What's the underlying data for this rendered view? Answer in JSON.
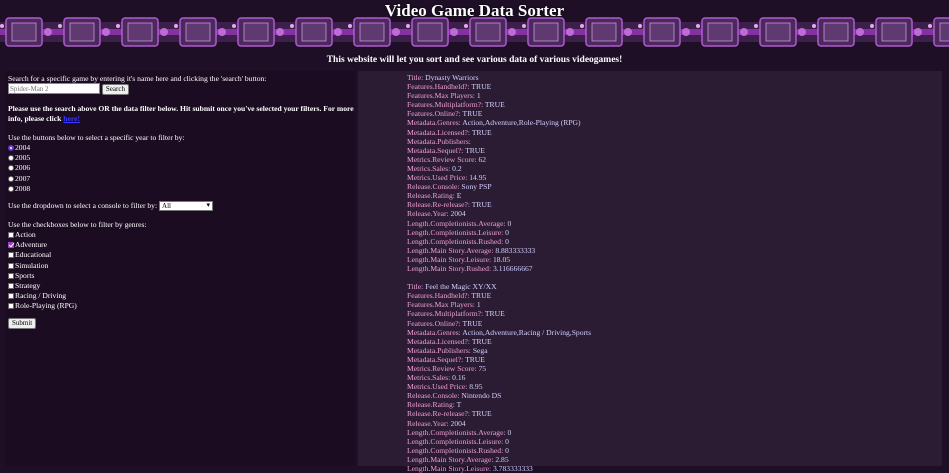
{
  "header": {
    "title": "Video Game Data Sorter",
    "subtitle": "This website will let you sort and see various data of various videogames!"
  },
  "search": {
    "instructions": "Search for a specific game by entering it's name here and clicking the 'search' button:",
    "placeholder": "Spider-Man 2",
    "button_label": "Search"
  },
  "filter_note": {
    "text": "Please use the search above OR the data filter below. Hit submit once you've selected your filters. For more info, please click",
    "link": "here!"
  },
  "year_filter": {
    "prompt": "Use the buttons below to select a specific year to filter by:",
    "options": [
      "2004",
      "2005",
      "2006",
      "2007",
      "2008"
    ],
    "selected": "2004"
  },
  "console_filter": {
    "prompt": "Use the dropdown to select a console to filter by:",
    "selected": "All"
  },
  "genre_filter": {
    "prompt": "Use the checkboxes below to filter by genres:",
    "options": [
      {
        "label": "Action",
        "checked": false
      },
      {
        "label": "Adventure",
        "checked": true
      },
      {
        "label": "Educational",
        "checked": false
      },
      {
        "label": "Simulation",
        "checked": false
      },
      {
        "label": "Sports",
        "checked": false
      },
      {
        "label": "Strategy",
        "checked": false
      },
      {
        "label": "Racing / Driving",
        "checked": false
      },
      {
        "label": "Role-Playing (RPG)",
        "checked": false
      }
    ]
  },
  "submit_label": "Submit",
  "results": [
    [
      [
        "Title: ",
        "Dynasty Warriors"
      ],
      [
        "Features.Handheld?: ",
        "TRUE"
      ],
      [
        "Features.Max Players: ",
        "1"
      ],
      [
        "Features.Multiplatform?: ",
        "TRUE"
      ],
      [
        "Features.Online?: ",
        "TRUE"
      ],
      [
        "Metadata.Genres: ",
        "Action,Adventure,Role-Playing (RPG)"
      ],
      [
        "Metadata.Licensed?: ",
        "TRUE"
      ],
      [
        "Metadata.Publishers:",
        ""
      ],
      [
        "Metadata.Sequel?: ",
        "TRUE"
      ],
      [
        "Metrics.Review Score: ",
        "62"
      ],
      [
        "Metrics.Sales: ",
        "0.2"
      ],
      [
        "Metrics.Used Price: ",
        "14.95"
      ],
      [
        "Release.Console: ",
        "Sony PSP"
      ],
      [
        "Release.Rating: ",
        "E"
      ],
      [
        "Release.Re-release?: ",
        "TRUE"
      ],
      [
        "Release.Year: ",
        "2004"
      ],
      [
        "Length.Completionists.Average: ",
        "0"
      ],
      [
        "Length.Completionists.Leisure: ",
        "0"
      ],
      [
        "Length.Completionists.Rushed: ",
        "0"
      ],
      [
        "Length.Main Story.Average: ",
        "8.883333333"
      ],
      [
        "Length.Main Story.Leisure: ",
        "18.05"
      ],
      [
        "Length.Main Story.Rushed: ",
        "3.116666667"
      ]
    ],
    [
      [
        "Title: ",
        "Feel the Magic XY/XX"
      ],
      [
        "Features.Handheld?: ",
        "TRUE"
      ],
      [
        "Features.Max Players: ",
        "1"
      ],
      [
        "Features.Multiplatform?: ",
        "TRUE"
      ],
      [
        "Features.Online?: ",
        "TRUE"
      ],
      [
        "Metadata.Genres: ",
        "Action,Adventure,Racing / Driving,Sports"
      ],
      [
        "Metadata.Licensed?: ",
        "TRUE"
      ],
      [
        "Metadata.Publishers: ",
        "Sega"
      ],
      [
        "Metadata.Sequel?: ",
        "TRUE"
      ],
      [
        "Metrics.Review Score: ",
        "75"
      ],
      [
        "Metrics.Sales: ",
        "0.16"
      ],
      [
        "Metrics.Used Price: ",
        "8.95"
      ],
      [
        "Release.Console: ",
        "Nintendo DS"
      ],
      [
        "Release.Rating: ",
        "T"
      ],
      [
        "Release.Re-release?: ",
        "TRUE"
      ],
      [
        "Release.Year: ",
        "2004"
      ],
      [
        "Length.Completionists.Average: ",
        "0"
      ],
      [
        "Length.Completionists.Leisure: ",
        "0"
      ],
      [
        "Length.Completionists.Rushed: ",
        "0"
      ],
      [
        "Length.Main Story.Average: ",
        "2.85"
      ],
      [
        "Length.Main Story.Leisure: ",
        "3.783333333"
      ]
    ]
  ],
  "colors": {
    "background": "#1e0f26",
    "panel_left": "#1b0c22",
    "panel_right": "#2b1b33",
    "banner_accent": "#a23bc8",
    "key_text": "#f0a0d8",
    "value_text": "#d2d2ff"
  }
}
